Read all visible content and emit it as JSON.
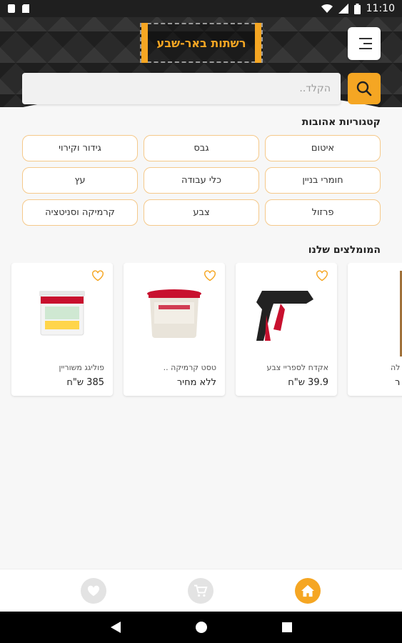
{
  "status_bar": {
    "time": "11:10"
  },
  "header": {
    "logo_text": "רשתות באר-שבע"
  },
  "search": {
    "placeholder": "הקלד.."
  },
  "categories": {
    "title": "קטגוריות אהובות",
    "items": [
      {
        "label": "איטום"
      },
      {
        "label": "גבס"
      },
      {
        "label": "גידור וקירוי"
      },
      {
        "label": "חומרי בניין"
      },
      {
        "label": "כלי עבודה"
      },
      {
        "label": "עץ"
      },
      {
        "label": "פרזול"
      },
      {
        "label": "צבע"
      },
      {
        "label": "קרמיקה וסניטציה"
      }
    ]
  },
  "recommended": {
    "title": "המומלצים שלנו",
    "products": [
      {
        "name": "פוליגג משוריין",
        "price": "385 ש\"ח"
      },
      {
        "name": "טסט קרמיקה ..",
        "price": "ללא מחיר"
      },
      {
        "name": "אקדח לספריי צבע",
        "price": "39.9 ש\"ח"
      },
      {
        "name": "לה",
        "price": "ר"
      }
    ]
  },
  "colors": {
    "accent": "#f5a623",
    "header_bg": "#2a2a2a"
  },
  "icons": [
    "menu-icon",
    "search-icon",
    "heart-icon",
    "home-icon",
    "cart-icon",
    "favorites-icon",
    "back-icon",
    "home-circle-icon",
    "recents-icon"
  ]
}
